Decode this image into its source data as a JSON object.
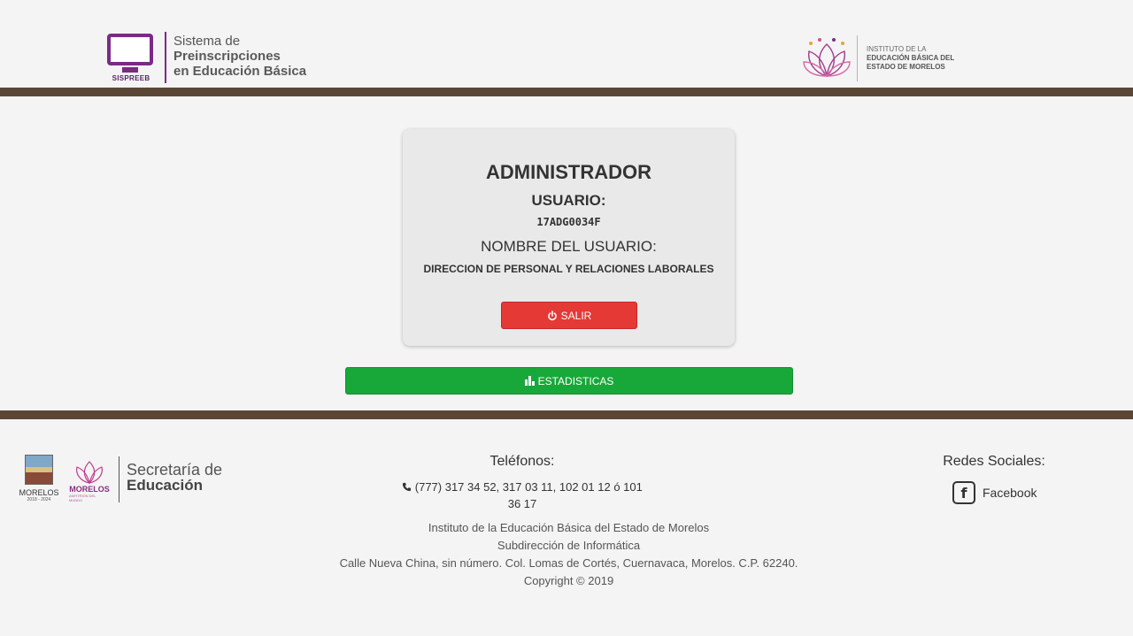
{
  "header": {
    "logo_caption": "SISPREEB",
    "title_line1": "Sistema de",
    "title_line2": "Preinscripciones",
    "title_line3": "en Educación Básica",
    "institute_line1": "INSTITUTO DE LA",
    "institute_line2": "EDUCACIÓN BÁSICA DEL",
    "institute_line3": "ESTADO DE MORELOS"
  },
  "card": {
    "role": "ADMINISTRADOR",
    "user_label": "USUARIO:",
    "user_id": "17ADG0034F",
    "name_label": "NOMBRE DEL USUARIO:",
    "user_name": "DIRECCION DE PERSONAL Y RELACIONES LABORALES",
    "logout_label": "SALIR",
    "logout_icon": "power-icon"
  },
  "stats_button": {
    "label": "ESTADISTICAS",
    "icon": "bar-chart-icon"
  },
  "footer": {
    "crest_name": "MORELOS",
    "crest_years": "2018 - 2024",
    "lotus_name": "MORELOS",
    "lotus_sub": "ANFITRIÓN DEL MUNDO",
    "sec_line1": "Secretaría de",
    "sec_line2": "Educación",
    "phones_title": "Teléfonos:",
    "phones_line1": "(777) 317 34 52, 317 03 11, 102 01 12 ó 101",
    "phones_line2": "36 17",
    "info_line1": "Instituto de la Educación Básica del Estado de Morelos",
    "info_line2": "Subdirección de Informática",
    "info_line3": "Calle Nueva China, sin número. Col. Lomas de Cortés, Cuernavaca, Morelos. C.P. 62240.",
    "info_line4": "Copyright © 2019",
    "social_title": "Redes Sociales:",
    "facebook_label": "Facebook"
  },
  "colors": {
    "brand_purple": "#7b2a86",
    "band_brown": "#5b4636",
    "logout_red": "#e53935",
    "stats_green": "#18a83a"
  }
}
